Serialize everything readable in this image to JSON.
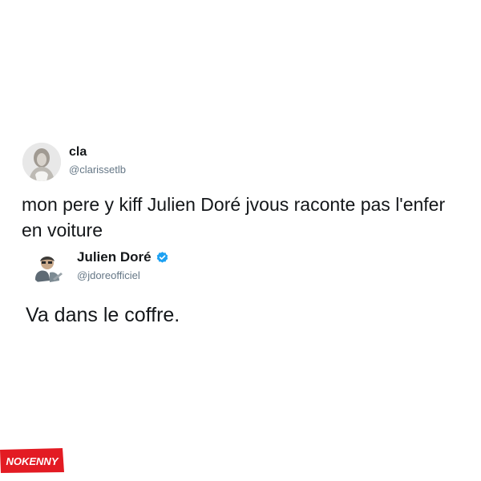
{
  "tweet": {
    "author_name": "cla",
    "author_handle": "@clarissetlb",
    "text": "mon pere y kiff Julien Doré jvous raconte pas l'enfer en voiture"
  },
  "reply": {
    "author_name": "Julien Doré",
    "author_handle": "@jdoreofficiel",
    "text": "Va dans le coffre.",
    "verified_icon": "verified-badge-icon"
  },
  "watermark": {
    "text": "NOKENNY"
  },
  "colors": {
    "background": "#ffffff",
    "text_primary": "#14171a",
    "text_secondary": "#657786",
    "verified_blue": "#1da1f2",
    "watermark_red": "#e31b23"
  }
}
